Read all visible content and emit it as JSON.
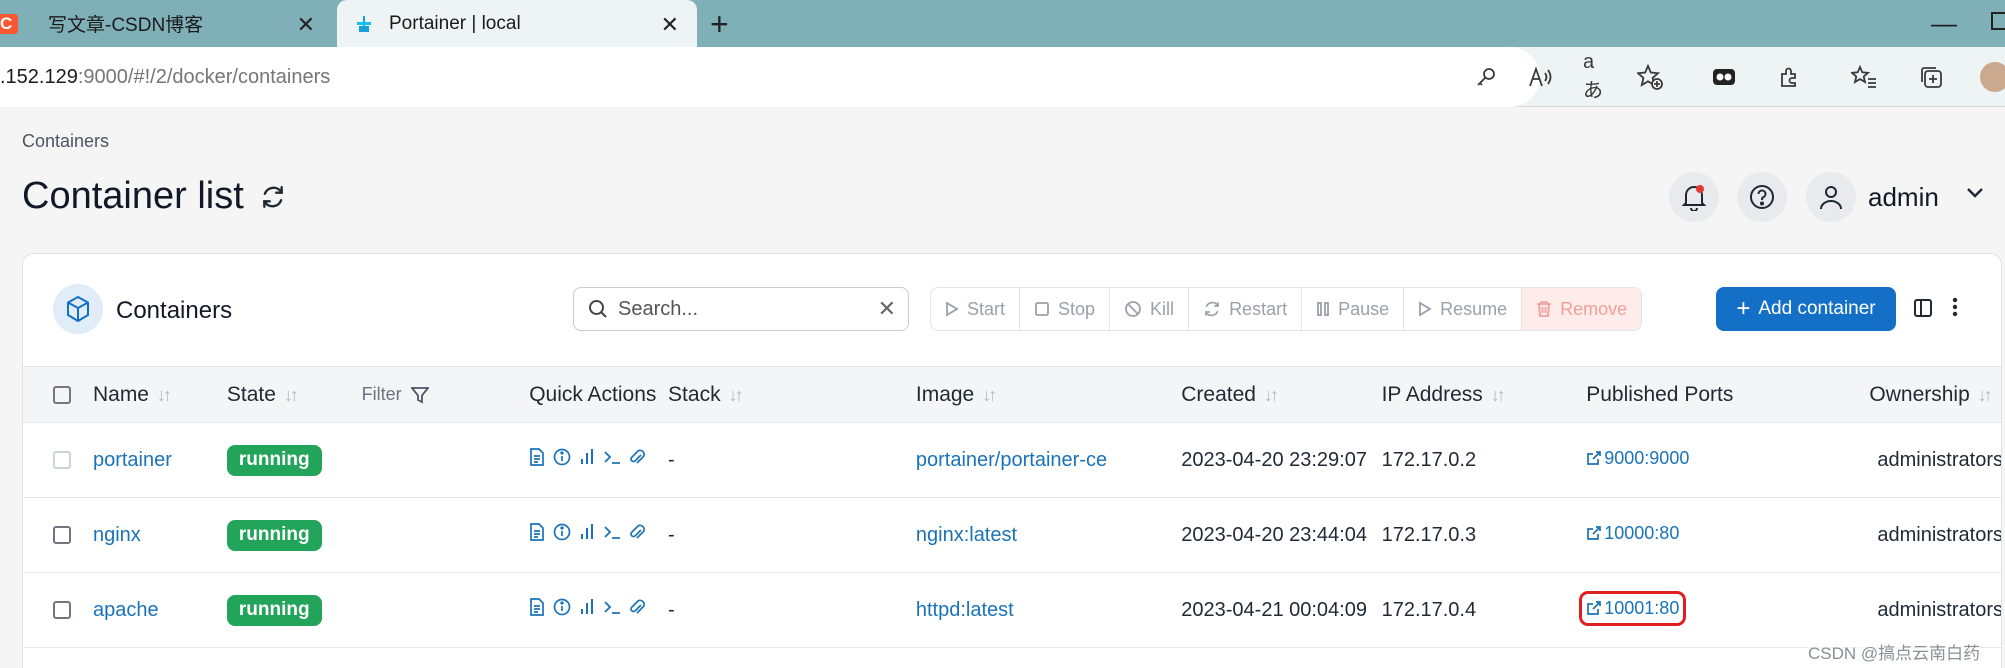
{
  "browser": {
    "tabs": [
      {
        "title": "写文章-CSDN博客",
        "favicon": "csdn-icon",
        "favicon_text": "C"
      },
      {
        "title": "Portainer | local",
        "favicon": "portainer-icon"
      }
    ],
    "url_host": ".152.129",
    "url_rest": ":9000/#!/2/docker/containers"
  },
  "page": {
    "breadcrumb": "Containers",
    "title": "Container list",
    "user": "admin"
  },
  "card": {
    "title": "Containers",
    "search_placeholder": "Search...",
    "actions": [
      "Start",
      "Stop",
      "Kill",
      "Restart",
      "Pause",
      "Resume",
      "Remove"
    ],
    "add_label": "Add container"
  },
  "table": {
    "headers": {
      "name": "Name",
      "state": "State",
      "filter": "Filter",
      "quick_actions": "Quick Actions",
      "stack": "Stack",
      "image": "Image",
      "created": "Created",
      "ip": "IP Address",
      "ports": "Published Ports",
      "ownership": "Ownership"
    },
    "rows": [
      {
        "name": "portainer",
        "state": "running",
        "stack": "-",
        "image": "portainer/portainer-ce",
        "created": "2023-04-20 23:29:07",
        "ip": "172.17.0.2",
        "port": "9000:9000",
        "ownership": "administrators"
      },
      {
        "name": "nginx",
        "state": "running",
        "stack": "-",
        "image": "nginx:latest",
        "created": "2023-04-20 23:44:04",
        "ip": "172.17.0.3",
        "port": "10000:80",
        "ownership": "administrators"
      },
      {
        "name": "apache",
        "state": "running",
        "stack": "-",
        "image": "httpd:latest",
        "created": "2023-04-21 00:04:09",
        "ip": "172.17.0.4",
        "port": "10001:80",
        "ownership": "administrators"
      }
    ]
  },
  "watermark": "CSDN @搞点云南白药",
  "colors": {
    "accent": "#1470c6",
    "running": "#22a55b",
    "link": "#1a73b8",
    "highlight": "#e02020"
  }
}
